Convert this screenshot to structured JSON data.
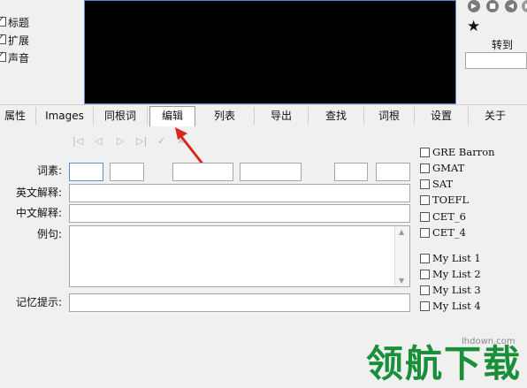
{
  "top_options": [
    {
      "label": "标题",
      "checked": true
    },
    {
      "label": "扩展",
      "checked": true
    },
    {
      "label": "声音",
      "checked": true
    }
  ],
  "right_panel": {
    "goto_label": "转到",
    "goto_value": "",
    "star_icon": "star-icon",
    "media_icons": [
      "play-icon",
      "stop-icon",
      "back-icon",
      "forward-icon"
    ]
  },
  "tabs": [
    "属性",
    "Images",
    "同根词",
    "编辑",
    "列表",
    "导出",
    "查找",
    "词根",
    "设置",
    "关于"
  ],
  "active_tab": "编辑",
  "toolbar_icons": [
    "first-icon",
    "prev-icon",
    "next-icon",
    "last-icon",
    "edit-icon",
    "delete-icon"
  ],
  "fields": {
    "morpheme_label": "词素:",
    "english_label": "英文解释:",
    "chinese_label": "中文解释:",
    "example_label": "例句:",
    "memory_label": "记忆提示:"
  },
  "word_lists": [
    {
      "label": "GRE Barron",
      "checked": false
    },
    {
      "label": "GMAT",
      "checked": false
    },
    {
      "label": "SAT",
      "checked": false
    },
    {
      "label": "TOEFL",
      "checked": false
    },
    {
      "label": "CET_6",
      "checked": false
    },
    {
      "label": "CET_4",
      "checked": false
    }
  ],
  "my_lists": [
    {
      "label": "My List 1",
      "checked": false
    },
    {
      "label": "My List 2",
      "checked": false
    },
    {
      "label": "My List 3",
      "checked": false
    },
    {
      "label": "My List 4",
      "checked": false
    }
  ],
  "watermark": {
    "text": "领航下载",
    "site": "lhdown.com"
  },
  "colors": {
    "video_bg": "#000000",
    "accent_border": "#5a8fd6",
    "arrow": "#d9261c",
    "watermark": "#1a8f3a"
  }
}
